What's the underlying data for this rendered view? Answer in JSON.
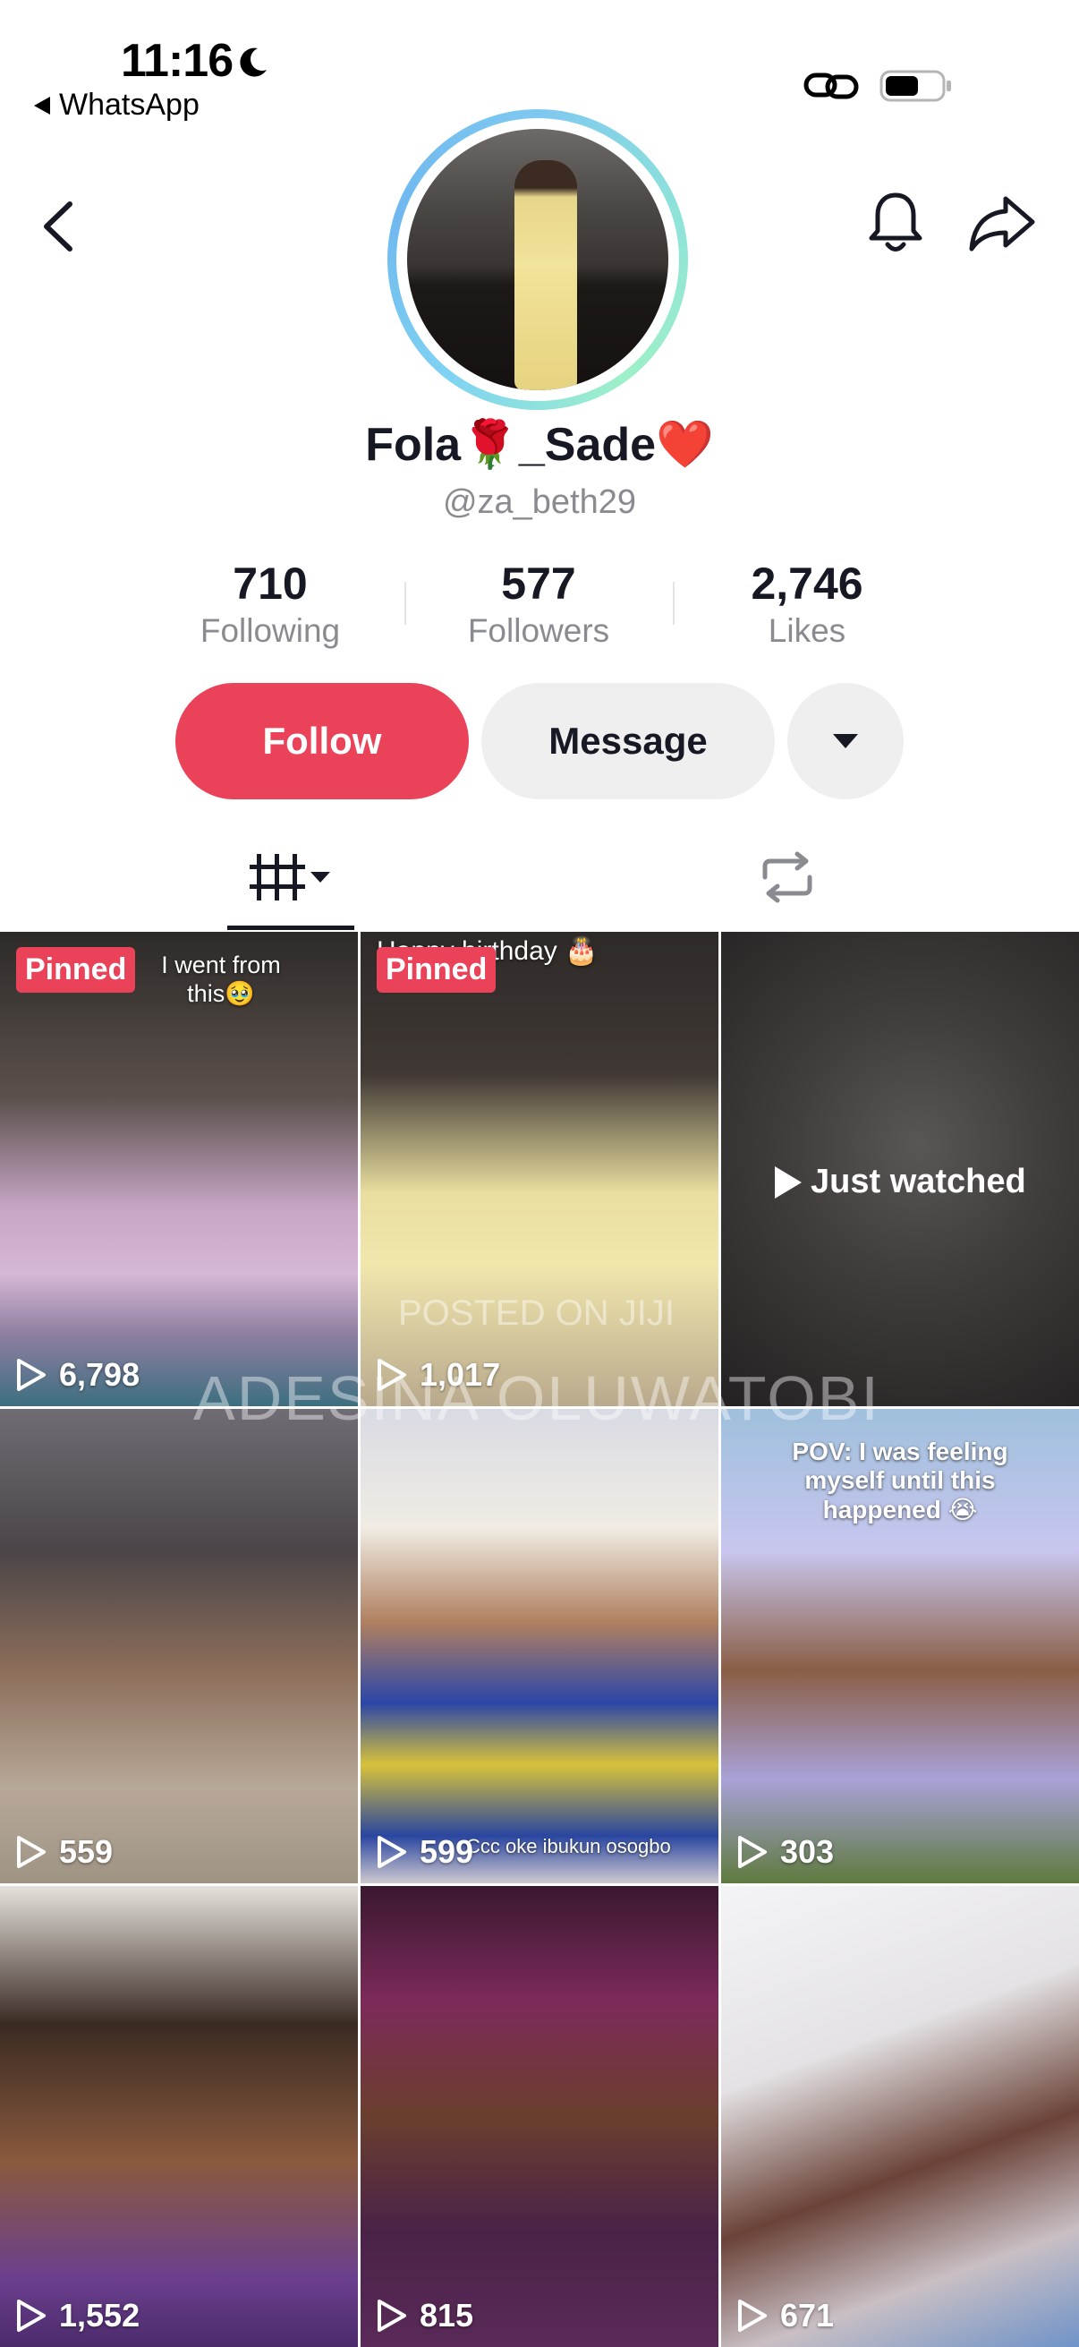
{
  "status_bar": {
    "time": "11:16",
    "back_app": "WhatsApp",
    "icons": [
      "moon-icon",
      "link-icon",
      "battery-icon"
    ]
  },
  "nav": {
    "icons": [
      "chevron-left-icon",
      "bell-icon",
      "share-icon"
    ]
  },
  "profile": {
    "display_name": "Fola🌹_Sade❤️",
    "username": "@za_beth29"
  },
  "stats": [
    {
      "value": "710",
      "label": "Following"
    },
    {
      "value": "577",
      "label": "Followers"
    },
    {
      "value": "2,746",
      "label": "Likes"
    }
  ],
  "actions": {
    "follow": "Follow",
    "message": "Message",
    "accent": "#ea4359"
  },
  "tabs": [
    "videos-grid-icon",
    "reposts-icon"
  ],
  "videos": [
    {
      "views": "6,798",
      "pinned": "Pinned",
      "caption": "I went from this🥹"
    },
    {
      "views": "1,017",
      "pinned": "Pinned",
      "caption": "Happy birthday 🎂",
      "overlay": "POSTED ON JIJI"
    },
    {
      "status": "Just watched"
    },
    {
      "views": "559"
    },
    {
      "views": "599",
      "caption": "Ccc oke ibukun osogbo"
    },
    {
      "views": "303",
      "caption": "POV: I was feeling myself until this happened 😭"
    },
    {
      "views": "1,552"
    },
    {
      "views": "815"
    },
    {
      "views": "671"
    }
  ],
  "watermark": "ADESINA OLUWATOBI"
}
